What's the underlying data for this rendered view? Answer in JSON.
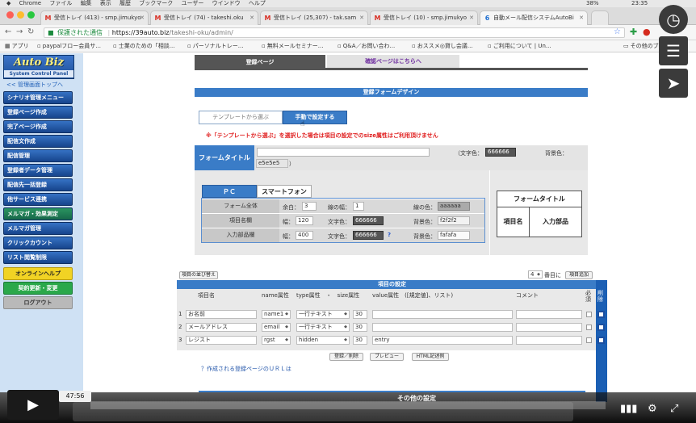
{
  "menubar": {
    "items": [
      "Chrome",
      "ファイル",
      "編集",
      "表示",
      "履歴",
      "ブックマーク",
      "ユーザー",
      "ウインドウ",
      "ヘルプ"
    ],
    "clock": "23:35",
    "battery": "38%"
  },
  "tabs": [
    {
      "label": "受信トレイ (413) - smp.jimukyo",
      "icon": "gmail-icon"
    },
    {
      "label": "受信トレイ (74) - takeshi.oku",
      "icon": "gmail-icon"
    },
    {
      "label": "受信トレイ (25,307) - tak.sam",
      "icon": "gmail-icon"
    },
    {
      "label": "受信トレイ (10) - smp.jimukyo",
      "icon": "gmail-icon"
    },
    {
      "label": "自動メール配信システムAutoBi",
      "icon": "autobiz-icon"
    }
  ],
  "address": {
    "secure_label": "保護された通信",
    "host": "https://39auto.biz",
    "path": "/takeshi-oku/admin/"
  },
  "bookmarks": [
    "アプリ",
    "paypalフロー会員サ...",
    "士業のための「相談...",
    "パーソナルトレー...",
    "無料メールセミナー...",
    "Q&A／お問い合わ...",
    "おススメ◎貸し会議...",
    "ご利用について | Un...",
    "その他のブ"
  ],
  "sidebar": {
    "logo_title": "Auto Biz",
    "logo_sub": "System Control Panel",
    "top_link": "<< 管理画面トップへ",
    "items": [
      {
        "label": "シナリオ管理メニュー",
        "style": "blue"
      },
      {
        "label": "登録ページ作成",
        "style": "blue"
      },
      {
        "label": "完了ページ作成",
        "style": "blue"
      },
      {
        "label": "配信文作成",
        "style": "blue"
      },
      {
        "label": "配信管理",
        "style": "blue"
      },
      {
        "label": "登録者データ管理",
        "style": "blue"
      },
      {
        "label": "配信先一括登録",
        "style": "blue"
      },
      {
        "label": "他サービス連携",
        "style": "blue"
      },
      {
        "label": "メルマガ・効果測定",
        "style": "green"
      },
      {
        "label": "メルマガ管理",
        "style": "blue"
      },
      {
        "label": "クリックカウント",
        "style": "blue"
      },
      {
        "label": "リスト閲覧制限",
        "style": "blue"
      },
      {
        "label": "オンラインヘルプ",
        "style": "yellow"
      },
      {
        "label": "契約更新・変更",
        "style": "lgreen"
      },
      {
        "label": "ログアウト",
        "style": "gray"
      }
    ]
  },
  "main": {
    "tab_register": "登録ページ",
    "tab_confirm": "確認ページはこちらへ",
    "form_design_title": "登録フォームデザイン",
    "seg_template": "テンプレートから選ぶ",
    "seg_manual": "手動で設定する",
    "warning": "※「テンプレートから選ぶ」を選択した場合は項目の設定でのsize属性はご利用頂けません",
    "form_title_label": "フォームタイトル",
    "text_color_label": "（文字色：",
    "text_color_value": "666666",
    "bg_color_label": "背景色：",
    "bg_color_value": "e5e5e5",
    "close_paren": "）",
    "pc_tab": "ＰＣ",
    "sp_tab": "スマートフォン",
    "rows": [
      {
        "label": "フォーム全体",
        "a_label": "余白：",
        "a_value": "3",
        "b_label": "線の幅：",
        "b_value": "1",
        "c_label": "線の色：",
        "c_value": "aaaaaa"
      },
      {
        "label": "項目名欄",
        "a_label": "幅：",
        "a_value": "120",
        "b_label": "文字色：",
        "b_value": "666666",
        "c_label": "背景色：",
        "c_value": "f2f2f2"
      },
      {
        "label": "入力部品欄",
        "a_label": "幅：",
        "a_value": "400",
        "b_label": "文字色：",
        "b_value": "666666",
        "c_label": "背景色：",
        "c_value": "fafafa"
      }
    ],
    "help_mark": "?",
    "preview": {
      "title": "フォームタイトル",
      "name": "項目名",
      "input": "入力部品"
    }
  },
  "items": {
    "reorder_button": "項目の並び替え",
    "position_value": "4",
    "position_suffix": "番目に",
    "add_button": "項目追加",
    "title": "項目の設定",
    "headers": {
      "name": "項目名",
      "name_attr": "name属性",
      "type_attr": "type属性　・　size属性",
      "value_attr": "value属性　([規定値]、リスト)",
      "comment": "コメント",
      "required": "必須",
      "delete": "削除"
    },
    "rows": [
      {
        "no": "1",
        "name": "お名前",
        "name_attr": "name1",
        "type": "一行テキスト",
        "size": "30",
        "value": "",
        "comment": ""
      },
      {
        "no": "2",
        "name": "メールアドレス",
        "name_attr": "email",
        "type": "一行テキスト",
        "size": "30",
        "value": "",
        "comment": ""
      },
      {
        "no": "3",
        "name": "レジスト",
        "name_attr": "rgst",
        "type": "hidden",
        "size": "30",
        "value": "entry",
        "comment": ""
      }
    ],
    "btn_register_delete": "登録／削除",
    "btn_preview": "プレビュー",
    "btn_html": "HTML記述例",
    "help_link": "？作成される登録ページのＵＲＬは",
    "other_settings": "その他の設定"
  },
  "video": {
    "time": "47:56",
    "progress_fraction": 0.0
  }
}
